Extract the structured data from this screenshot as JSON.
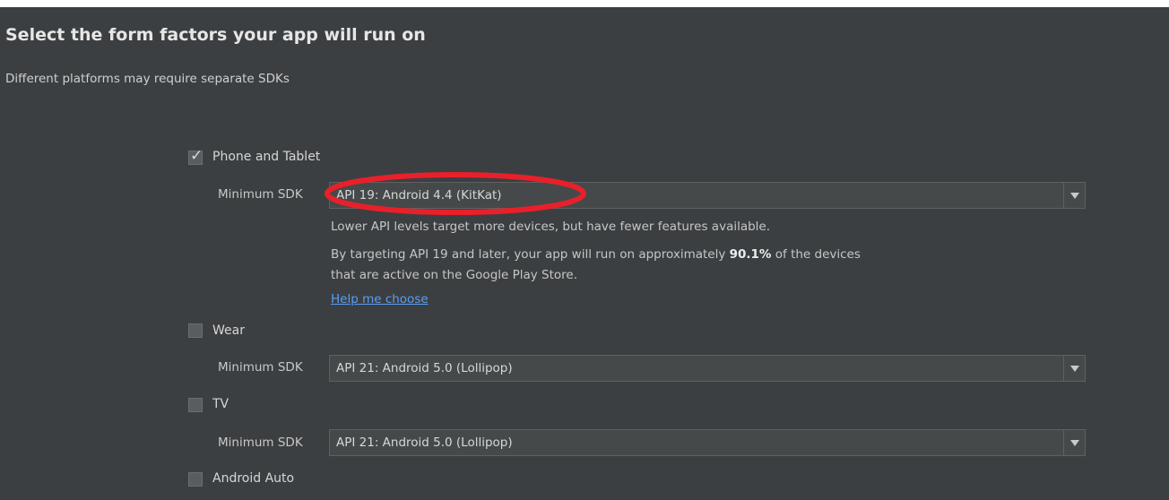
{
  "header": {
    "title": "Select the form factors your app will run on",
    "subtitle": "Different platforms may require separate SDKs"
  },
  "form_factors": [
    {
      "label": "Phone and Tablet",
      "checked": true,
      "sdk_label": "Minimum SDK",
      "sdk_value": "API 19: Android 4.4 (KitKat)"
    },
    {
      "label": "Wear",
      "checked": false,
      "sdk_label": "Minimum SDK",
      "sdk_value": "API 21: Android 5.0 (Lollipop)"
    },
    {
      "label": "TV",
      "checked": false,
      "sdk_label": "Minimum SDK",
      "sdk_value": "API 21: Android 5.0 (Lollipop)"
    },
    {
      "label": "Android Auto",
      "checked": false
    }
  ],
  "phone_info": {
    "line1": "Lower API levels target more devices, but have fewer features available.",
    "line2_prefix": "By targeting API 19 and later, your app will run on approximately ",
    "line2_percent": "90.1%",
    "line2_suffix": " of the devices",
    "line3": "that are active on the Google Play Store.",
    "help_link": "Help me choose"
  },
  "colors": {
    "background": "#3c3f41",
    "annotation_circle": "#e8202a",
    "link": "#589df6"
  }
}
